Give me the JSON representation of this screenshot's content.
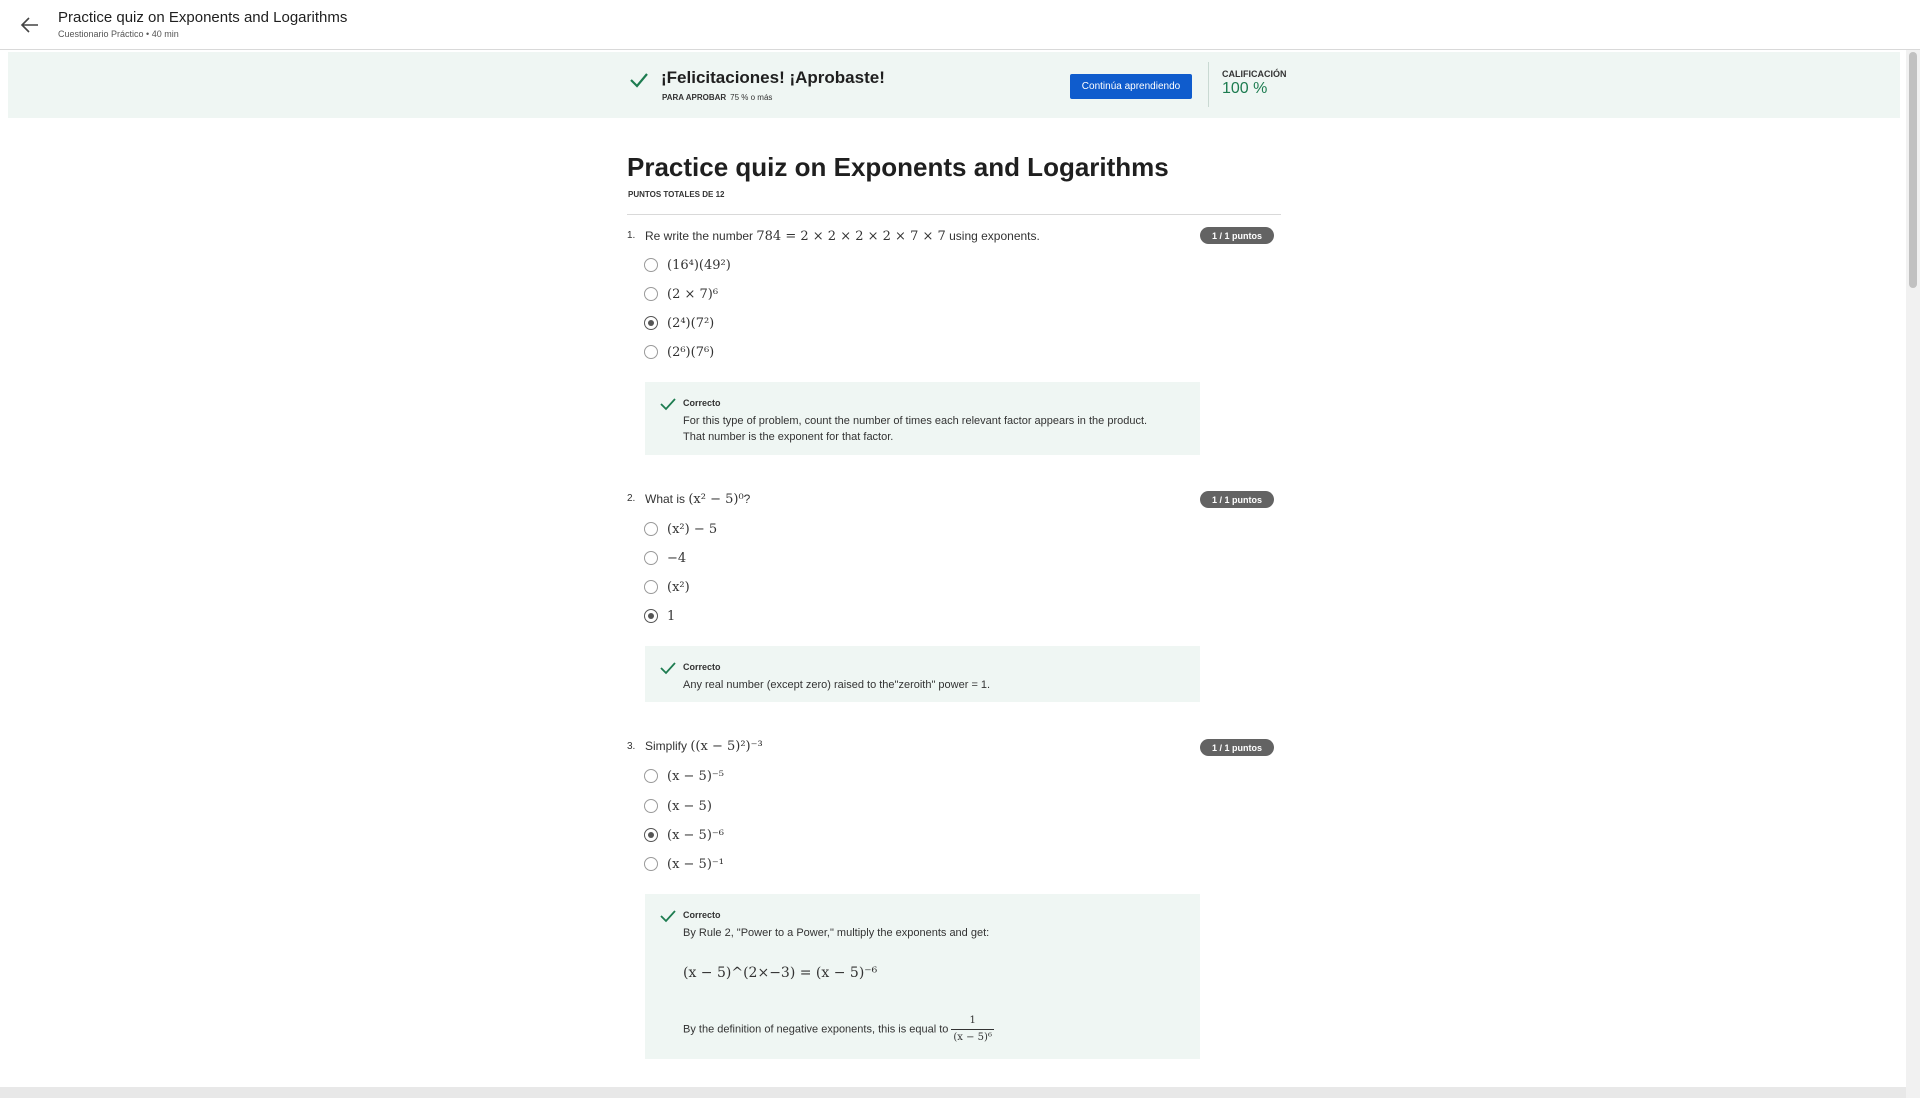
{
  "header": {
    "back_icon": "arrow-left-icon",
    "title": "Practice quiz on Exponents and Logarithms",
    "subtitle": "Cuestionario Práctico • 40 min"
  },
  "banner": {
    "title": "¡Felicitaciones! ¡Aprobaste!",
    "pass_label": "PARA APROBAR",
    "pass_value": "75 % o más",
    "continue_label": "Continúa aprendiendo",
    "grade_label": "CALIFICACIÓN",
    "grade_value": "100 %",
    "accent_color": "#1d7c50",
    "button_color": "#0f5ccd"
  },
  "quiz": {
    "title": "Practice quiz on Exponents and Logarithms",
    "total_points": "PUNTOS TOTALES DE 12",
    "questions": [
      {
        "number": "1.",
        "text_before": "Re write the number ",
        "math": "784 = 2 × 2 × 2 × 2 × 7 × 7",
        "text_after": " using exponents.",
        "points": "1 / 1 puntos",
        "options": [
          "(16⁴)(49²)",
          "(2 × 7)⁶",
          "(2⁴)(7²)",
          "(2⁶)(7⁶)"
        ],
        "selected": 2,
        "feedback": {
          "title": "Correcto",
          "line1": "For this type of problem, count the number of times each relevant factor appears in the product.",
          "line2": "That number is the exponent for that factor."
        }
      },
      {
        "number": "2.",
        "text_before": "What is ",
        "math": "(x² − 5)⁰",
        "text_after": "?",
        "points": "1 / 1 puntos",
        "options": [
          "(x²) − 5",
          "−4",
          "(x²)",
          "1"
        ],
        "selected": 3,
        "feedback": {
          "title": "Correcto",
          "line1": "Any real number (except zero) raised to the\"zeroith\" power = 1."
        }
      },
      {
        "number": "3.",
        "text_before": "Simplify ",
        "math": "((x − 5)²)⁻³",
        "text_after": "",
        "points": "1 / 1 puntos",
        "options": [
          "(x − 5)⁻⁵",
          "(x − 5)",
          "(x − 5)⁻⁶",
          "(x − 5)⁻¹"
        ],
        "selected": 2,
        "feedback": {
          "title": "Correcto",
          "line1": "By Rule 2, \"Power to a Power,\" multiply the exponents and get:",
          "equation": "(x − 5)^(2×−3) = (x − 5)⁻⁶",
          "line2": "By the definition of negative exponents, this is equal to",
          "frac_num": "1",
          "frac_den": "(x − 5)⁶"
        }
      }
    ]
  }
}
